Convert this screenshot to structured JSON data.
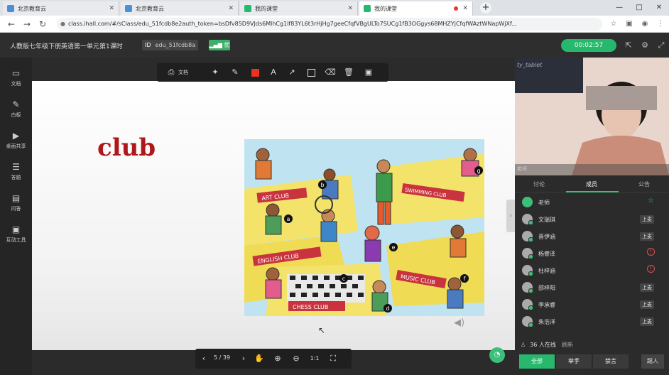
{
  "browser": {
    "tabs": [
      {
        "title": "北京教育云",
        "active": false
      },
      {
        "title": "北京教育云",
        "active": false
      },
      {
        "title": "我的课堂",
        "active": false
      },
      {
        "title": "我的课堂",
        "active": true
      }
    ],
    "url": "class.ihall.com/#/sClass/edu_51fcdb8e2auth_token=bsDfv85D9VJds6MlhCg1lf83YL6t3rHjHg7geeCfqfVBgULTo7SUCg1fB3OGgys68MHZYjCfqfWAztWNapWjXf...",
    "new_tab": "+",
    "win_controls": [
      "—",
      "□",
      "✕"
    ]
  },
  "header": {
    "lesson_title": "人教版七年级下册英语第一单元第1课时",
    "id_label": "ID",
    "id_value": "edu_51fcdb8a",
    "signal_label": "优",
    "timer": "00:02:57"
  },
  "sidebar": [
    {
      "label": "文档",
      "icon": "document-icon"
    },
    {
      "label": "白板",
      "icon": "whiteboard-icon"
    },
    {
      "label": "桌面共享",
      "icon": "screen-share-icon"
    },
    {
      "label": "答题",
      "icon": "quiz-icon"
    },
    {
      "label": "问答",
      "icon": "qa-icon"
    },
    {
      "label": "互动工具",
      "icon": "toolbox-icon"
    }
  ],
  "drawbar": {
    "doc_label": "文档"
  },
  "slide": {
    "word": "club"
  },
  "illustration_signs": [
    "ART CLUB",
    "SWIMMING CLUB",
    "ENGLISH CLUB",
    "MUSIC CLUB",
    "CHESS CLUB"
  ],
  "illustration_letters": [
    "a",
    "b",
    "c",
    "d",
    "e",
    "f",
    "g"
  ],
  "pagebar": {
    "page": "5 / 39"
  },
  "video": {
    "tablet_text": "ty_tablet",
    "teacher_name": "老师"
  },
  "tabs": [
    "讨论",
    "成员",
    "公告"
  ],
  "members": [
    {
      "name": "老师",
      "type": "teacher",
      "action": ""
    },
    {
      "name": "文瑞琪",
      "type": "student",
      "action": "上麦"
    },
    {
      "name": "晋伊涵",
      "type": "student",
      "action": "上麦"
    },
    {
      "name": "杨睿泽",
      "type": "student",
      "action": "warn"
    },
    {
      "name": "杜梓涵",
      "type": "student",
      "action": "warn"
    },
    {
      "name": "邵梓阳",
      "type": "student",
      "action": "上麦"
    },
    {
      "name": "李承睿",
      "type": "student",
      "action": "上麦"
    },
    {
      "name": "朱浩洋",
      "type": "student",
      "action": "上麦"
    }
  ],
  "footer": {
    "online": "36 人在线",
    "refresh": "刷新",
    "segments": [
      "全部",
      "举手",
      "禁言"
    ],
    "out": "踢人"
  },
  "colors": {
    "accent": "#27b86e",
    "word": "#b0171a",
    "danger": "#e34e4e"
  }
}
